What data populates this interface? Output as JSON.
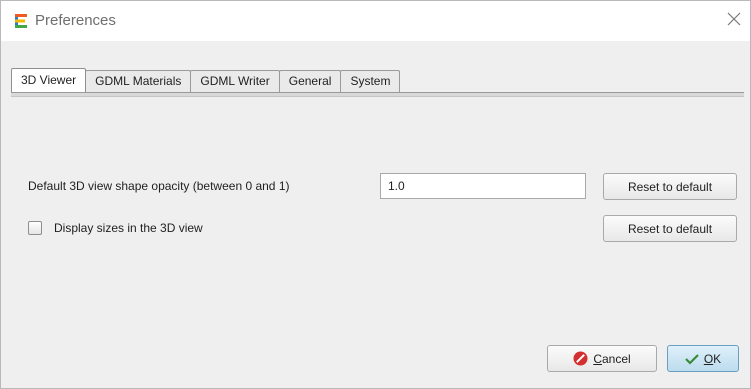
{
  "window": {
    "title": "Preferences",
    "icon": "app-e-icon",
    "close_icon": "close-icon"
  },
  "tabs": [
    {
      "label": "3D Viewer",
      "active": true
    },
    {
      "label": "GDML Materials",
      "active": false
    },
    {
      "label": "GDML Writer",
      "active": false
    },
    {
      "label": "General",
      "active": false
    },
    {
      "label": "System",
      "active": false
    }
  ],
  "viewer": {
    "opacity_label": "Default 3D view shape opacity (between 0 and 1)",
    "opacity_value": "1.0",
    "display_sizes_label": "Display sizes in the 3D view",
    "display_sizes_checked": false,
    "reset_label": "Reset to default"
  },
  "footer": {
    "cancel": {
      "underlined": "C",
      "rest": "ancel",
      "icon": "cancel-icon",
      "icon_color": "#d32f2f"
    },
    "ok": {
      "underlined": "O",
      "rest": "K",
      "icon": "checkmark-icon",
      "icon_color": "#3a8a3a"
    }
  },
  "colors": {
    "panel_bg": "#efefef",
    "window_bg": "#ffffff",
    "ok_button_bg": "#cfe6f3"
  }
}
